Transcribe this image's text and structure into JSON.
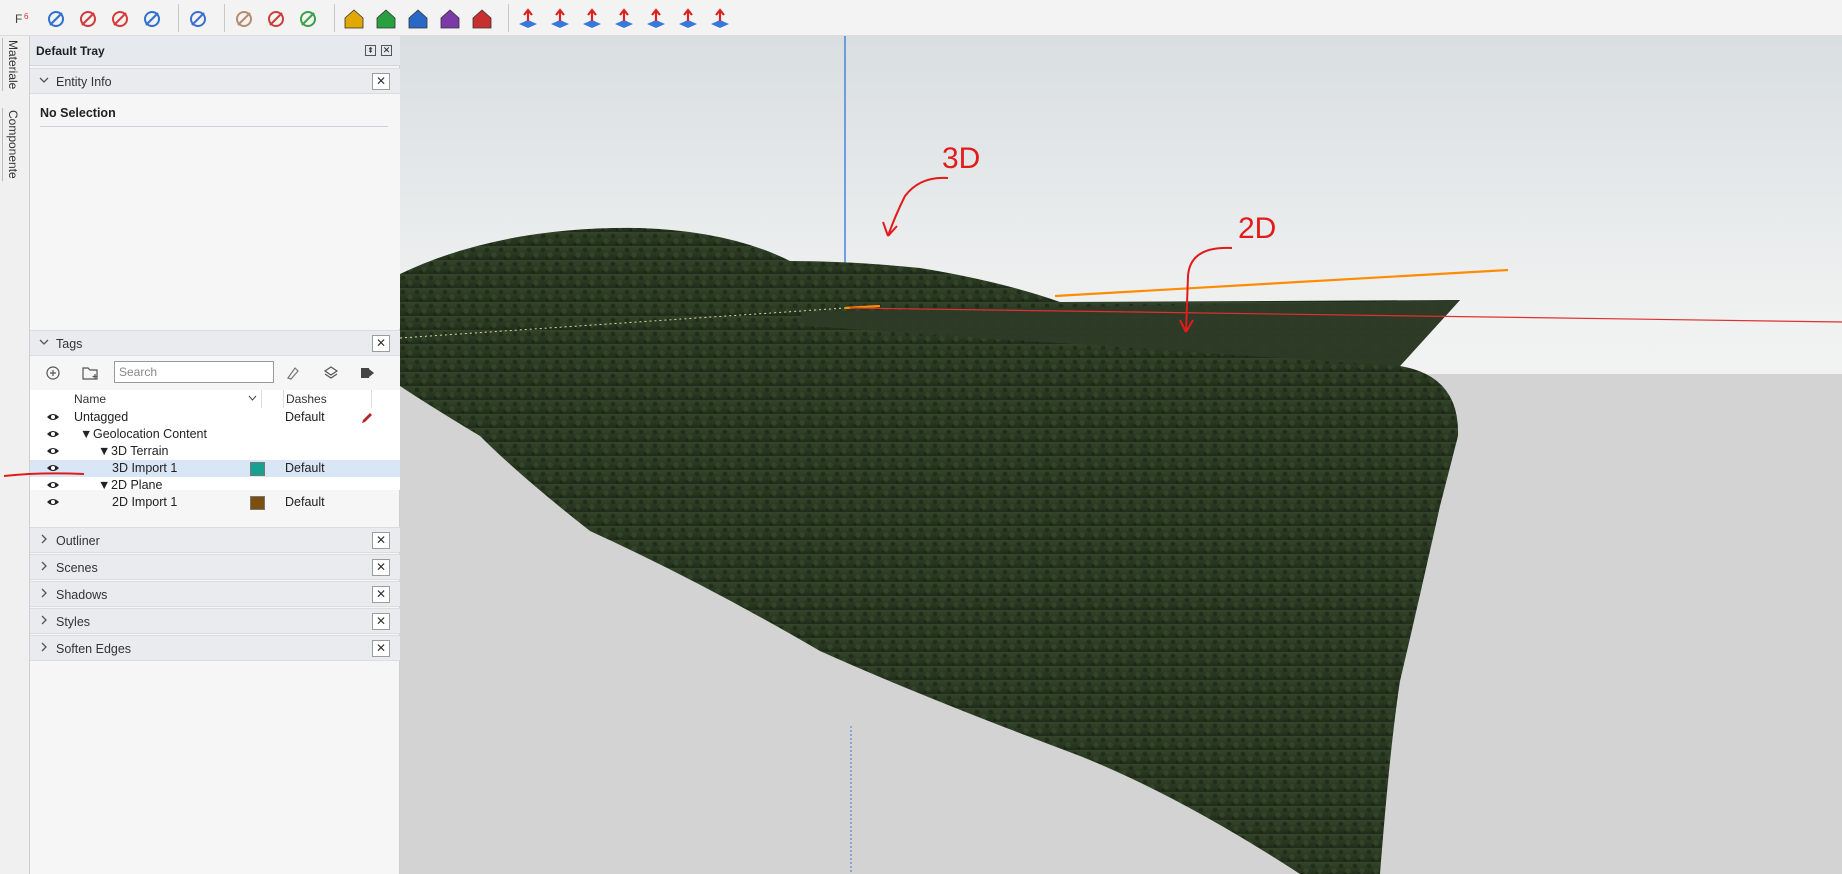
{
  "toolbar": {
    "groups": [
      [
        "f6-icon",
        "pencil-line-icon",
        "freehand-icon",
        "lifebuoy-icon",
        "brush-icon"
      ],
      [
        "scale-icon"
      ],
      [
        "rock-icon",
        "orbit-icon",
        "gem-icon"
      ],
      [
        "house-yellow-icon",
        "house-green-icon",
        "house-blue-icon",
        "house-purple-icon",
        "house-red-icon"
      ],
      [
        "push-pull-equal-icon",
        "push-pull-j-icon",
        "push-pull-r-icon",
        "push-pull-v-icon",
        "push-pull-n-icon",
        "push-pull-x-icon",
        "push-pull-f-icon"
      ]
    ]
  },
  "side_tabs": [
    "Materiale",
    "Componente"
  ],
  "tray": {
    "title": "Default Tray",
    "entity_info": {
      "header": "Entity Info",
      "selection": "No Selection"
    },
    "tags": {
      "header": "Tags",
      "search_placeholder": "Search",
      "columns": {
        "name": "Name",
        "color": "",
        "dashes": "Dashes"
      },
      "rows": [
        {
          "name": "Untagged",
          "dashes": "Default",
          "color": "",
          "indent": 0,
          "toggle": "",
          "selected": false
        },
        {
          "name": "Geolocation Content",
          "dashes": "",
          "color": "",
          "indent": 1,
          "toggle": "▼",
          "selected": false
        },
        {
          "name": "3D Terrain",
          "dashes": "",
          "color": "",
          "indent": 2,
          "toggle": "▼",
          "selected": false
        },
        {
          "name": "3D Import 1",
          "dashes": "Default",
          "color": "#16a191",
          "indent": 3,
          "toggle": "",
          "selected": true
        },
        {
          "name": "2D Plane",
          "dashes": "",
          "color": "",
          "indent": 2,
          "toggle": "▼",
          "selected": false
        },
        {
          "name": "2D Import 1",
          "dashes": "Default",
          "color": "#7a4f0f",
          "indent": 3,
          "toggle": "",
          "selected": false
        }
      ]
    },
    "collapsed_sections": [
      "Outliner",
      "Scenes",
      "Shadows",
      "Styles",
      "Soften Edges"
    ]
  },
  "viewport": {
    "annotations": [
      {
        "text": "3D"
      },
      {
        "text": "2D"
      }
    ],
    "colors": {
      "blue_axis": "#3c7fd8",
      "red_axis": "#e03030",
      "green_axis": "#2aa84a",
      "orange_edge": "#ff8c00",
      "annotation_red": "#e31b1b",
      "terrain": "#2b3b24"
    }
  }
}
